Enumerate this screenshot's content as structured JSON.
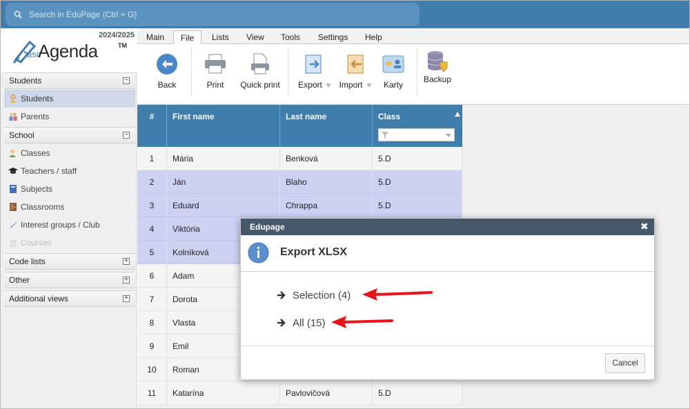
{
  "search": {
    "placeholder": "Search in EduPage (Ctrl + G)"
  },
  "brand": {
    "year": "2024/2025",
    "prefix": "asc",
    "name": "Agenda",
    "tm": "TM"
  },
  "sidebar": {
    "sections": [
      {
        "label": "Students",
        "toggle": "−",
        "items": [
          {
            "label": "Students",
            "icon": "student-icon",
            "active": true
          },
          {
            "label": "Parents",
            "icon": "parents-icon"
          }
        ]
      },
      {
        "label": "School",
        "toggle": "−",
        "items": [
          {
            "label": "Classes",
            "icon": "classes-icon"
          },
          {
            "label": "Teachers / staff",
            "icon": "graduation-cap-icon"
          },
          {
            "label": "Subjects",
            "icon": "book-icon"
          },
          {
            "label": "Classrooms",
            "icon": "door-icon"
          },
          {
            "label": "Interest groups / Club",
            "icon": "rocket-icon"
          },
          {
            "label": "Courses",
            "icon": "courses-icon",
            "disabled": true
          }
        ]
      },
      {
        "label": "Code lists",
        "toggle": "+"
      },
      {
        "label": "Other",
        "toggle": "+"
      },
      {
        "label": "Additional views",
        "toggle": "+"
      }
    ]
  },
  "menu": {
    "tabs": [
      "Main",
      "File",
      "Lists",
      "View",
      "Tools",
      "Settings",
      "Help"
    ],
    "active": "File"
  },
  "toolbar": {
    "back": "Back",
    "print": "Print",
    "quick_print": "Quick print",
    "export": "Export",
    "import": "Import",
    "karty": "Karty",
    "backup": "Backup"
  },
  "table": {
    "headers": {
      "num": "#",
      "first": "First name",
      "last": "Last name",
      "cls": "Class"
    },
    "rows": [
      {
        "n": "1",
        "first": "Mária",
        "last": "Benková",
        "cls": "5.D",
        "sel": false
      },
      {
        "n": "2",
        "first": "Ján",
        "last": "Blaho",
        "cls": "5.D",
        "sel": true
      },
      {
        "n": "3",
        "first": "Eduard",
        "last": "Chrappa",
        "cls": "5.D",
        "sel": true
      },
      {
        "n": "4",
        "first": "Viktória",
        "last": "",
        "cls": "",
        "sel": true
      },
      {
        "n": "5",
        "first": "Kolníková",
        "last": "",
        "cls": "",
        "sel": true
      },
      {
        "n": "6",
        "first": "Adam",
        "last": "",
        "cls": "",
        "sel": false
      },
      {
        "n": "7",
        "first": "Dorota",
        "last": "",
        "cls": "",
        "sel": false
      },
      {
        "n": "8",
        "first": "Vlasta",
        "last": "",
        "cls": "",
        "sel": false
      },
      {
        "n": "9",
        "first": "Emil",
        "last": "",
        "cls": "",
        "sel": false
      },
      {
        "n": "10",
        "first": "Roman",
        "last": "",
        "cls": "",
        "sel": false
      },
      {
        "n": "11",
        "first": "Katarína",
        "last": "Pavlovičová",
        "cls": "5.D",
        "sel": false
      }
    ]
  },
  "dialog": {
    "title": "Edupage",
    "close": "✖",
    "heading": "Export XLSX",
    "options": [
      "Selection (4)",
      "All (15)"
    ],
    "cancel": "Cancel"
  },
  "colors": {
    "header_blue": "#3f7dad",
    "selected_row": "#cdd1f2",
    "dialog_title": "#45596b",
    "arrow_red": "#e8141b"
  }
}
